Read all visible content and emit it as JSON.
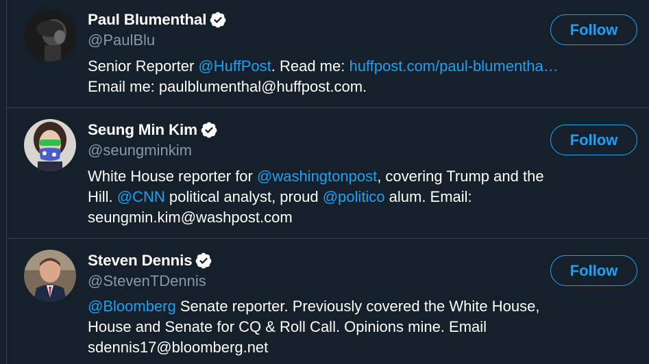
{
  "users": [
    {
      "name": "Paul Blumenthal",
      "handle": "@PaulBlu",
      "follow_label": "Follow",
      "bio": {
        "line1_a": "Senior Reporter ",
        "line1_link1": "@HuffPost",
        "line1_b": ". Read me: ",
        "line1_link2": "huffpost.com/paul-blumentha…",
        "line2": "Email me: paulblumenthal@huffpost.com."
      },
      "avatar_icon": "avatar-photo"
    },
    {
      "name": "Seung Min Kim",
      "handle": "@seungminkim",
      "follow_label": "Follow",
      "bio": {
        "line1_a": "White House reporter for ",
        "line1_link1": "@washingtonpost",
        "line1_b": ", covering Trump and the",
        "line2_a": "Hill. ",
        "line2_link1": "@CNN",
        "line2_b": " political analyst, proud ",
        "line2_link2": "@politico",
        "line2_c": " alum. Email:",
        "line3": "seungmin.kim@washpost.com"
      },
      "avatar_icon": "avatar-photo"
    },
    {
      "name": "Steven Dennis",
      "handle": "@StevenTDennis",
      "follow_label": "Follow",
      "bio": {
        "line1_link1": "@Bloomberg",
        "line1_b": " Senate reporter. Previously covered the White House,",
        "line2": "House and Senate for CQ & Roll Call. Opinions mine. Email",
        "line3": "sdennis17@bloomberg.net"
      },
      "avatar_icon": "avatar-photo"
    }
  ],
  "colors": {
    "background": "#15202b",
    "divider": "#38444d",
    "text_primary": "#ffffff",
    "text_secondary": "#8899a6",
    "accent": "#1da1f2"
  },
  "icons": {
    "verified": "verified-badge-icon"
  }
}
